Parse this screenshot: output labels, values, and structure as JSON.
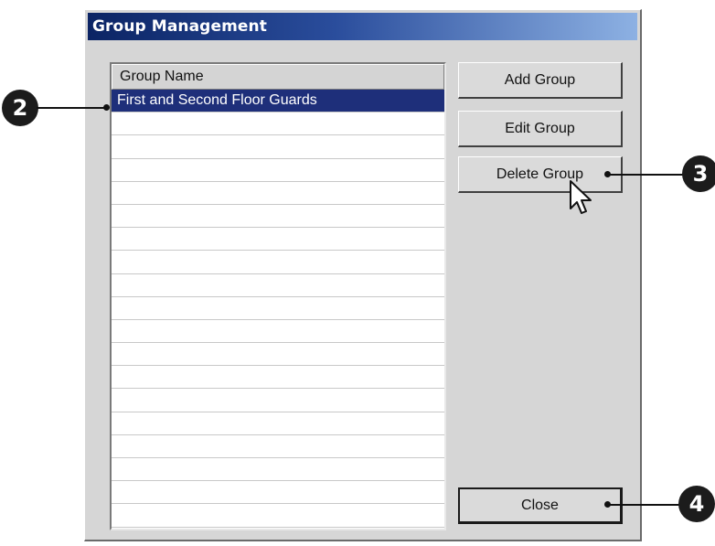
{
  "window": {
    "title": "Group Management"
  },
  "list": {
    "header": "Group Name",
    "rows": [
      "First and Second Floor Guards",
      "",
      "",
      "",
      "",
      "",
      "",
      "",
      "",
      "",
      "",
      "",
      "",
      "",
      "",
      "",
      "",
      "",
      ""
    ],
    "selected_index": 0
  },
  "buttons": {
    "add": "Add Group",
    "edit": "Edit Group",
    "delete": "Delete Group",
    "close": "Close"
  },
  "callouts": {
    "list": "2",
    "delete": "3",
    "close": "4"
  },
  "colors": {
    "title_start": "#0b2464",
    "title_end": "#8db1e3",
    "selection": "#1e2f7a"
  },
  "icons": {
    "pointer": "mouse-pointer-icon"
  }
}
